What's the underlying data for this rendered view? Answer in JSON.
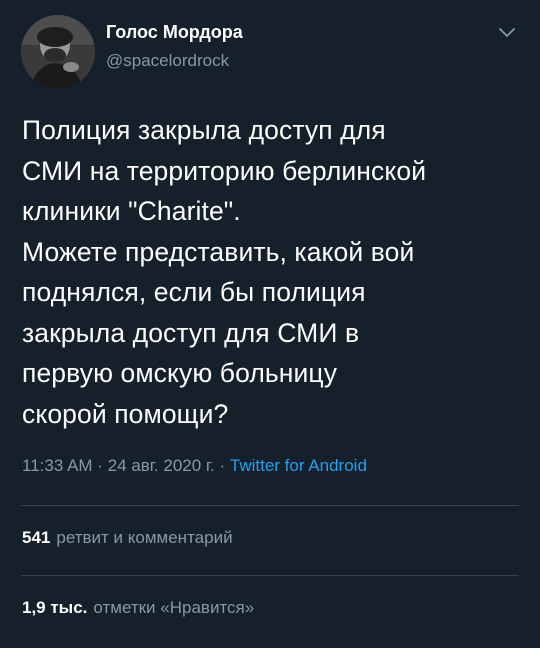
{
  "author": {
    "display_name": "Голос Мордора",
    "handle": "@spacelordrock",
    "avatar_icon": "avatar-photo"
  },
  "tweet": {
    "text": "Полиция закрыла доступ для\nСМИ на территорию берлинской\nклиники \"Charite\".\nМожете представить, какой вой\nподнялся, если бы полиция\nзакрыла доступ для СМИ в\nпервую омскую больницу\nскорой помощи?"
  },
  "meta": {
    "time": "11:33 AM",
    "sep1": " · ",
    "date": "24 авг. 2020 г.",
    "sep2": " · ",
    "source": "Twitter for Android"
  },
  "stats": {
    "retweets_count": "541",
    "retweets_label": "ретвит и комментарий",
    "likes_count": "1,9 тыс.",
    "likes_label": "отметки «Нравится»"
  },
  "colors": {
    "background": "#15202b",
    "text_primary": "#ffffff",
    "text_secondary": "#8899a6",
    "link": "#1da1f2",
    "divider": "#38444d"
  },
  "icons": {
    "menu": "chevron-down-icon"
  }
}
